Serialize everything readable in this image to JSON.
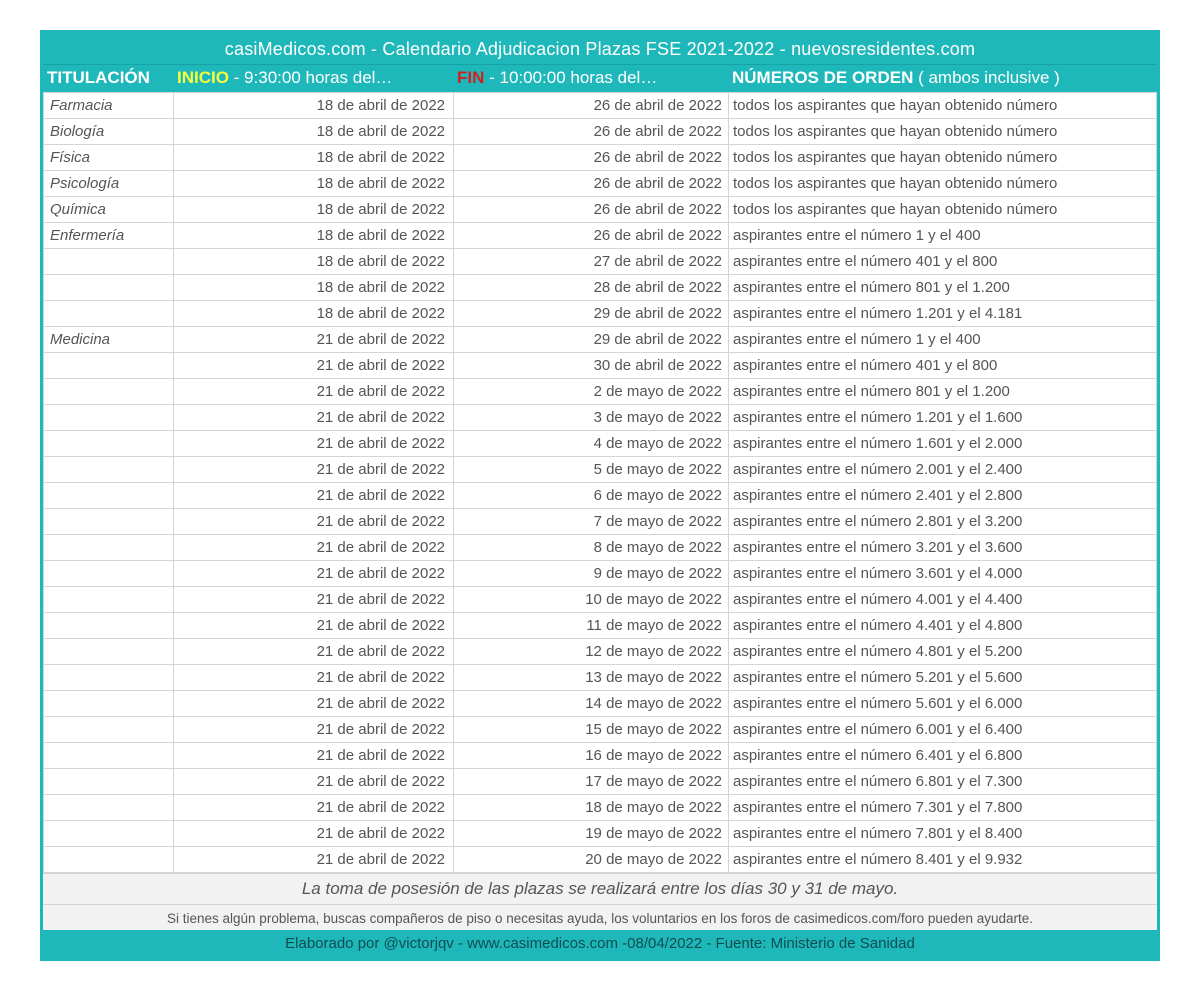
{
  "title": "casiMedicos.com - Calendario Adjudicacion Plazas FSE 2021-2022 - nuevosresidentes.com",
  "header": {
    "col1": "TITULACIÓN",
    "col2_accent": "INICIO",
    "col2_rest": " - 9:30:00 horas del…",
    "col3_accent": "FIN",
    "col3_rest": " - 10:00:00 horas del…",
    "col4_accent": "NÚMEROS DE ORDEN",
    "col4_rest": " ( ambos inclusive )"
  },
  "rows": [
    {
      "titulacion": "Farmacia",
      "inicio": "18 de abril de 2022",
      "fin": "26 de abril de 2022",
      "orden": "todos los aspirantes que hayan obtenido número"
    },
    {
      "titulacion": "Biología",
      "inicio": "18 de abril de 2022",
      "fin": "26 de abril de 2022",
      "orden": "todos los aspirantes que hayan obtenido número"
    },
    {
      "titulacion": "Física",
      "inicio": "18 de abril de 2022",
      "fin": "26 de abril de 2022",
      "orden": "todos los aspirantes que hayan obtenido número"
    },
    {
      "titulacion": "Psicología",
      "inicio": "18 de abril de 2022",
      "fin": "26 de abril de 2022",
      "orden": "todos los aspirantes que hayan obtenido número"
    },
    {
      "titulacion": "Química",
      "inicio": "18 de abril de 2022",
      "fin": "26 de abril de 2022",
      "orden": "todos los aspirantes que hayan obtenido número"
    },
    {
      "titulacion": "Enfermería",
      "inicio": "18 de abril de 2022",
      "fin": "26 de abril de 2022",
      "orden": "aspirantes  entre el número 1 y el 400"
    },
    {
      "titulacion": "",
      "inicio": "18 de abril de 2022",
      "fin": "27 de abril de 2022",
      "orden": "aspirantes  entre el número 401 y el 800"
    },
    {
      "titulacion": "",
      "inicio": "18 de abril de 2022",
      "fin": "28 de abril de 2022",
      "orden": "aspirantes  entre el número 801 y el 1.200"
    },
    {
      "titulacion": "",
      "inicio": "18 de abril de 2022",
      "fin": "29 de abril de 2022",
      "orden": "aspirantes  entre el número 1.201 y el 4.181"
    },
    {
      "titulacion": "Medicina",
      "inicio": "21 de abril de 2022",
      "fin": "29 de abril de 2022",
      "orden": "aspirantes  entre el número 1 y el 400"
    },
    {
      "titulacion": "",
      "inicio": "21 de abril de 2022",
      "fin": "30 de abril de 2022",
      "orden": "aspirantes  entre el número 401 y el 800"
    },
    {
      "titulacion": "",
      "inicio": "21 de abril de 2022",
      "fin": "2 de mayo de 2022",
      "orden": "aspirantes  entre el número 801 y el 1.200"
    },
    {
      "titulacion": "",
      "inicio": "21 de abril de 2022",
      "fin": "3 de mayo de 2022",
      "orden": "aspirantes  entre el número 1.201 y el 1.600"
    },
    {
      "titulacion": "",
      "inicio": "21 de abril de 2022",
      "fin": "4 de mayo de 2022",
      "orden": "aspirantes  entre el número 1.601 y el 2.000"
    },
    {
      "titulacion": "",
      "inicio": "21 de abril de 2022",
      "fin": "5 de mayo de 2022",
      "orden": "aspirantes  entre el número 2.001 y el 2.400"
    },
    {
      "titulacion": "",
      "inicio": "21 de abril de 2022",
      "fin": "6 de mayo de 2022",
      "orden": "aspirantes  entre el número 2.401 y el 2.800"
    },
    {
      "titulacion": "",
      "inicio": "21 de abril de 2022",
      "fin": "7 de mayo de 2022",
      "orden": "aspirantes  entre el número 2.801 y el 3.200"
    },
    {
      "titulacion": "",
      "inicio": "21 de abril de 2022",
      "fin": "8 de mayo de 2022",
      "orden": "aspirantes  entre el número 3.201 y el 3.600"
    },
    {
      "titulacion": "",
      "inicio": "21 de abril de 2022",
      "fin": "9 de mayo de 2022",
      "orden": "aspirantes  entre el número 3.601 y el 4.000"
    },
    {
      "titulacion": "",
      "inicio": "21 de abril de 2022",
      "fin": "10 de mayo de 2022",
      "orden": "aspirantes  entre el número 4.001 y el 4.400"
    },
    {
      "titulacion": "",
      "inicio": "21 de abril de 2022",
      "fin": "11 de mayo de 2022",
      "orden": "aspirantes  entre el número 4.401 y el 4.800"
    },
    {
      "titulacion": "",
      "inicio": "21 de abril de 2022",
      "fin": "12 de mayo de 2022",
      "orden": "aspirantes  entre el número 4.801 y el 5.200"
    },
    {
      "titulacion": "",
      "inicio": "21 de abril de 2022",
      "fin": "13 de mayo de 2022",
      "orden": "aspirantes  entre el número 5.201 y el 5.600"
    },
    {
      "titulacion": "",
      "inicio": "21 de abril de 2022",
      "fin": "14 de mayo de 2022",
      "orden": "aspirantes  entre el número 5.601 y el 6.000"
    },
    {
      "titulacion": "",
      "inicio": "21 de abril de 2022",
      "fin": "15 de mayo de 2022",
      "orden": "aspirantes  entre el número 6.001 y el 6.400"
    },
    {
      "titulacion": "",
      "inicio": "21 de abril de 2022",
      "fin": "16 de mayo de 2022",
      "orden": "aspirantes  entre el número 6.401 y el 6.800"
    },
    {
      "titulacion": "",
      "inicio": "21 de abril de 2022",
      "fin": "17 de mayo de 2022",
      "orden": "aspirantes  entre el número 6.801 y el 7.300"
    },
    {
      "titulacion": "",
      "inicio": "21 de abril de 2022",
      "fin": "18 de mayo de 2022",
      "orden": "aspirantes  entre el número 7.301 y el 7.800"
    },
    {
      "titulacion": "",
      "inicio": "21 de abril de 2022",
      "fin": "19 de mayo de 2022",
      "orden": "aspirantes  entre el número 7.801 y el 8.400"
    },
    {
      "titulacion": "",
      "inicio": "21 de abril de 2022",
      "fin": "20 de mayo de 2022",
      "orden": "aspirantes  entre el número 8.401 y el 9.932"
    }
  ],
  "footer": {
    "line1": "La toma de posesión de las plazas se realizará entre los días 30 y 31 de mayo.",
    "line2": "Si tienes algún problema, buscas compañeros de piso o necesitas ayuda, los voluntarios en los foros de casimedicos.com/foro pueden ayudarte.",
    "line3": "Elaborado por @victorjqv - www.casimedicos.com -08/04/2022 - Fuente: Ministerio de Sanidad"
  }
}
